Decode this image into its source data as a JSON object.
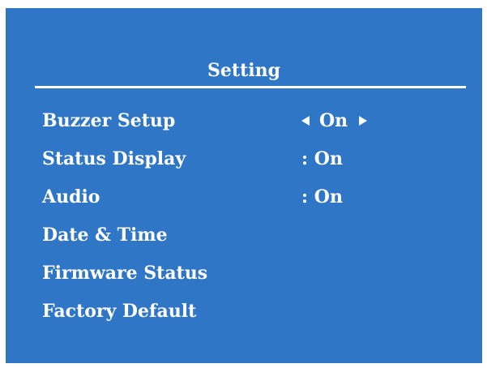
{
  "menu": {
    "title": "Setting",
    "items": [
      {
        "label": "Buzzer Setup",
        "value": "On"
      },
      {
        "label": "Status Display",
        "value": ": On"
      },
      {
        "label": "Audio",
        "value": ": On"
      },
      {
        "label": "Date & Time"
      },
      {
        "label": "Firmware Status"
      },
      {
        "label": "Factory Default"
      }
    ]
  },
  "colors": {
    "background": "#2f76c7",
    "text": "#ffffff"
  },
  "icons": {
    "left": "arrow-left-icon",
    "right": "arrow-right-icon"
  }
}
